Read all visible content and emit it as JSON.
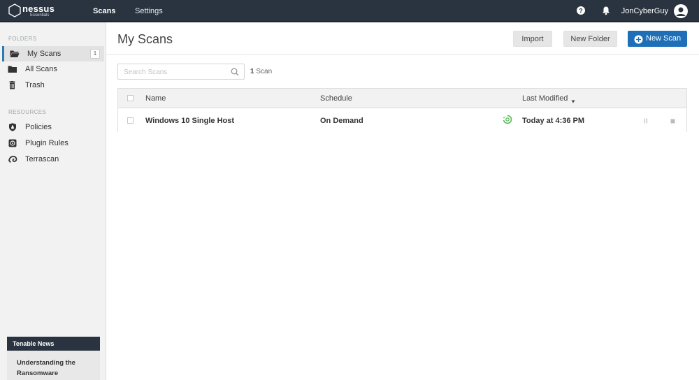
{
  "header": {
    "brand": "nessus",
    "brand_sub": "Essentials",
    "nav": [
      "Scans",
      "Settings"
    ],
    "username": "JonCyberGuy"
  },
  "sidebar": {
    "folders_label": "FOLDERS",
    "folders": [
      {
        "label": "My Scans",
        "count": "1",
        "icon": "folder-open-icon"
      },
      {
        "label": "All Scans",
        "icon": "folder-icon"
      },
      {
        "label": "Trash",
        "icon": "trash-icon"
      }
    ],
    "resources_label": "RESOURCES",
    "resources": [
      {
        "label": "Policies",
        "icon": "shield-icon"
      },
      {
        "label": "Plugin Rules",
        "icon": "plugin-rules-icon"
      },
      {
        "label": "Terrascan",
        "icon": "terrascan-icon"
      }
    ],
    "news": {
      "title": "Tenable News",
      "headline": "Understanding the Ransomware"
    }
  },
  "main": {
    "title": "My Scans",
    "buttons": {
      "import": "Import",
      "new_folder": "New Folder",
      "new_scan": "New Scan"
    },
    "search_placeholder": "Search Scans",
    "scan_count_num": "1",
    "scan_count_word": "Scan",
    "table": {
      "headers": {
        "name": "Name",
        "schedule": "Schedule",
        "last_modified": "Last Modified"
      },
      "rows": [
        {
          "name": "Windows 10 Single Host",
          "schedule": "On Demand",
          "last_modified": "Today at 4:36 PM",
          "status": "running"
        }
      ]
    }
  },
  "colors": {
    "topbar": "#2a3440",
    "accent": "#1e6fb7",
    "status_running": "#5cb85c"
  }
}
